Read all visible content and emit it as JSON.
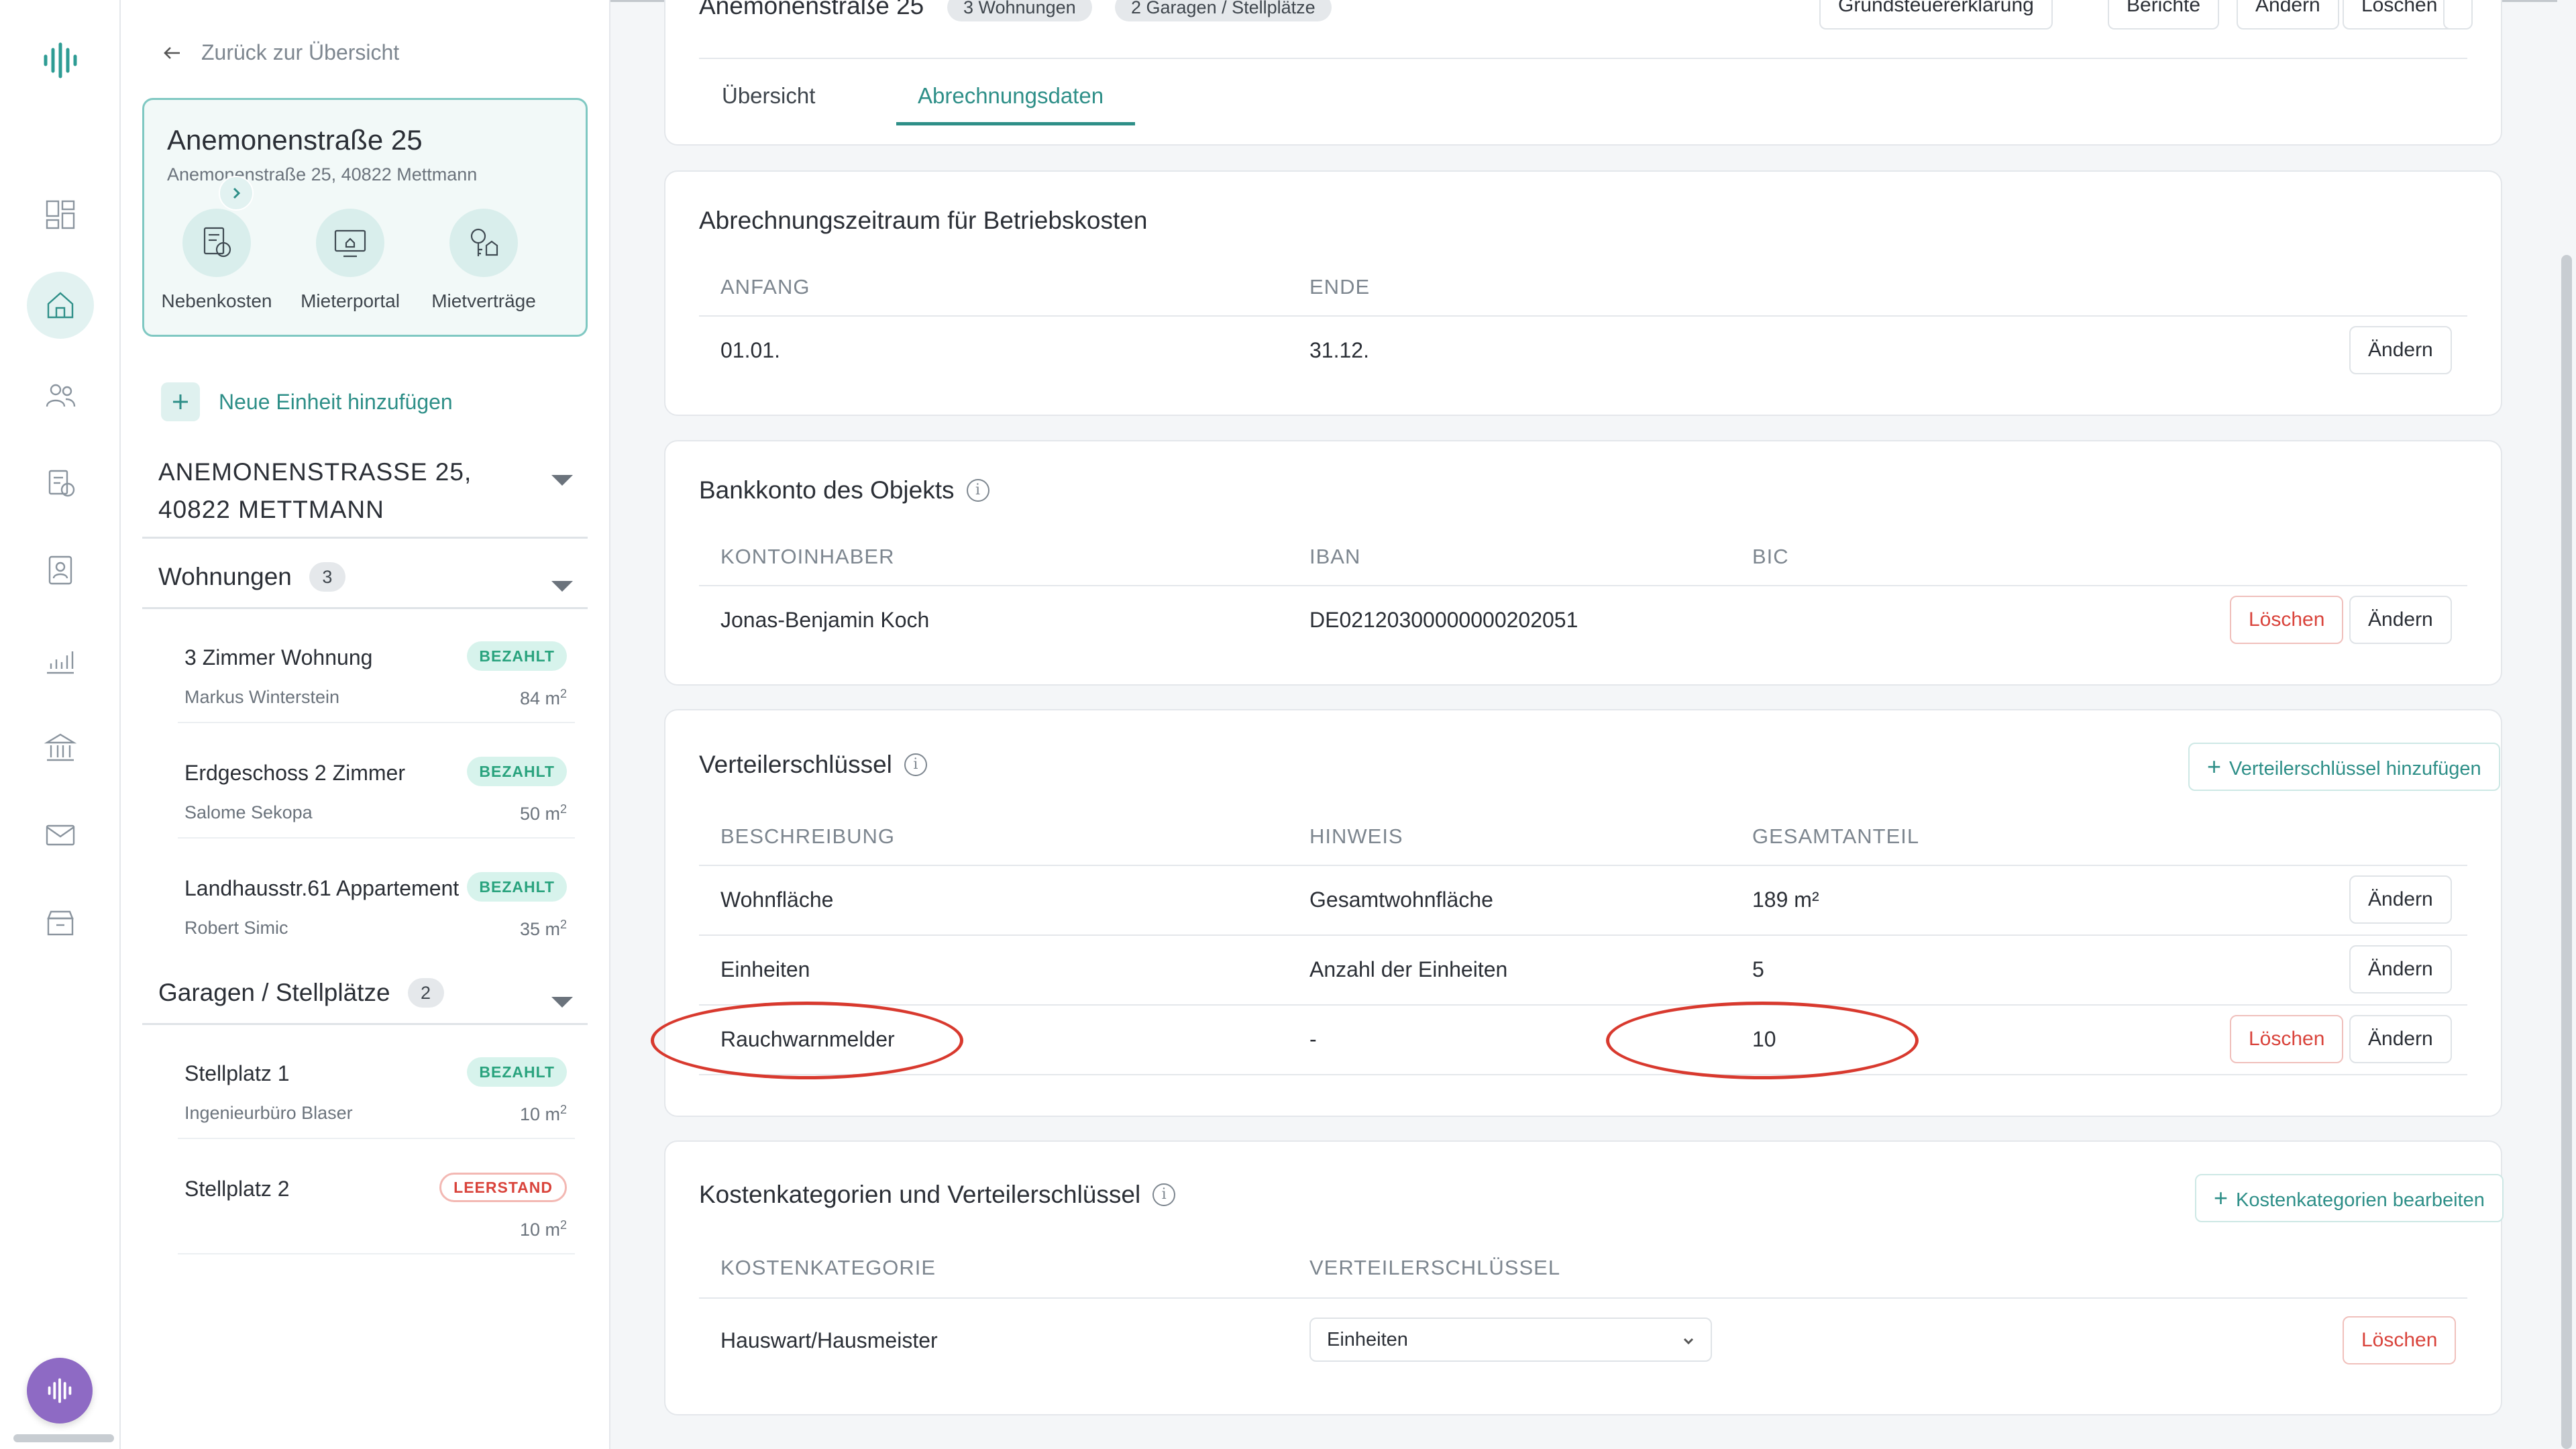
{
  "nav": {
    "items": [
      {
        "name": "dashboard-icon"
      },
      {
        "name": "home-icon",
        "active": true
      },
      {
        "name": "users-icon"
      },
      {
        "name": "billing-icon"
      },
      {
        "name": "contact-card-icon"
      },
      {
        "name": "chart-icon"
      },
      {
        "name": "bank-icon"
      },
      {
        "name": "mail-icon"
      },
      {
        "name": "archive-icon"
      }
    ]
  },
  "sidebar": {
    "back_label": "Zurück zur Übersicht",
    "property": {
      "title": "Anemonenstraße 25",
      "address": "Anemonenstraße 25, 40822 Mettmann",
      "quick_links": [
        "Nebenkosten",
        "Mieterportal",
        "Mietverträge"
      ]
    },
    "new_unit_label": "Neue Einheit hinzufügen",
    "address_group": {
      "line1": "ANEMONENSTRASSE 25,",
      "line2": "40822 METTMANN"
    },
    "apartments": {
      "label": "Wohnungen",
      "count": "3",
      "units": [
        {
          "name": "3 Zimmer Wohnung",
          "tenant": "Markus Winterstein",
          "area": "84 m",
          "status": "BEZAHLT"
        },
        {
          "name": "Erdgeschoss 2 Zimmer",
          "tenant": "Salome Sekopa",
          "area": "50 m",
          "status": "BEZAHLT"
        },
        {
          "name": "Landhausstr.61 Appartement",
          "tenant": "Robert Simic",
          "area": "35 m",
          "status": "BEZAHLT"
        }
      ]
    },
    "garages": {
      "label": "Garagen / Stellplätze",
      "count": "2",
      "units": [
        {
          "name": "Stellplatz 1",
          "tenant": "Ingenieurbüro Blaser",
          "area": "10 m",
          "status": "BEZAHLT"
        },
        {
          "name": "Stellplatz 2",
          "tenant": "",
          "area": "10 m",
          "status": "LEERSTAND"
        }
      ]
    },
    "area_sup": "2"
  },
  "header": {
    "title": "Anemonenstraße 25",
    "badges": [
      "3 Wohnungen",
      "2 Garagen / Stellplätze"
    ],
    "actions": [
      "Grundsteuererklärung",
      "Berichte",
      "Ändern",
      "Löschen"
    ],
    "tabs": [
      "Übersicht",
      "Abrechnungsdaten"
    ],
    "active_tab": "Abrechnungsdaten"
  },
  "period": {
    "title": "Abrechnungszeitraum für Betriebskosten",
    "cols": [
      "ANFANG",
      "ENDE"
    ],
    "row": {
      "start": "01.01.",
      "end": "31.12."
    },
    "edit_label": "Ändern"
  },
  "bank": {
    "title": "Bankkonto des Objekts",
    "cols": [
      "KONTOINHABER",
      "IBAN",
      "BIC"
    ],
    "row": {
      "holder": "Jonas-Benjamin Koch",
      "iban": "DE02120300000000202051",
      "bic": ""
    },
    "delete_label": "Löschen",
    "edit_label": "Ändern"
  },
  "keys": {
    "title": "Verteilerschlüssel",
    "add_label": "Verteilerschlüssel hinzufügen",
    "cols": [
      "BESCHREIBUNG",
      "HINWEIS",
      "GESAMTANTEIL"
    ],
    "rows": [
      {
        "desc": "Wohnfläche",
        "hint": "Gesamtwohnfläche",
        "total": "189 m²",
        "deletable": false
      },
      {
        "desc": "Einheiten",
        "hint": "Anzahl der Einheiten",
        "total": "5",
        "deletable": false
      },
      {
        "desc": "Rauchwarnmelder",
        "hint": "-",
        "total": "10",
        "deletable": true
      }
    ],
    "delete_label": "Löschen",
    "edit_label": "Ändern"
  },
  "categories": {
    "title": "Kostenkategorien und Verteilerschlüssel",
    "edit_label": "Kostenkategorien bearbeiten",
    "cols": [
      "KOSTENKATEGORIE",
      "VERTEILERSCHLÜSSEL"
    ],
    "rows": [
      {
        "category": "Hauswart/Hausmeister",
        "key": "Einheiten"
      }
    ],
    "delete_label": "Löschen"
  },
  "colors": {
    "accent": "#2e8f88",
    "danger": "#d9433b",
    "annotation": "#d8392e"
  }
}
